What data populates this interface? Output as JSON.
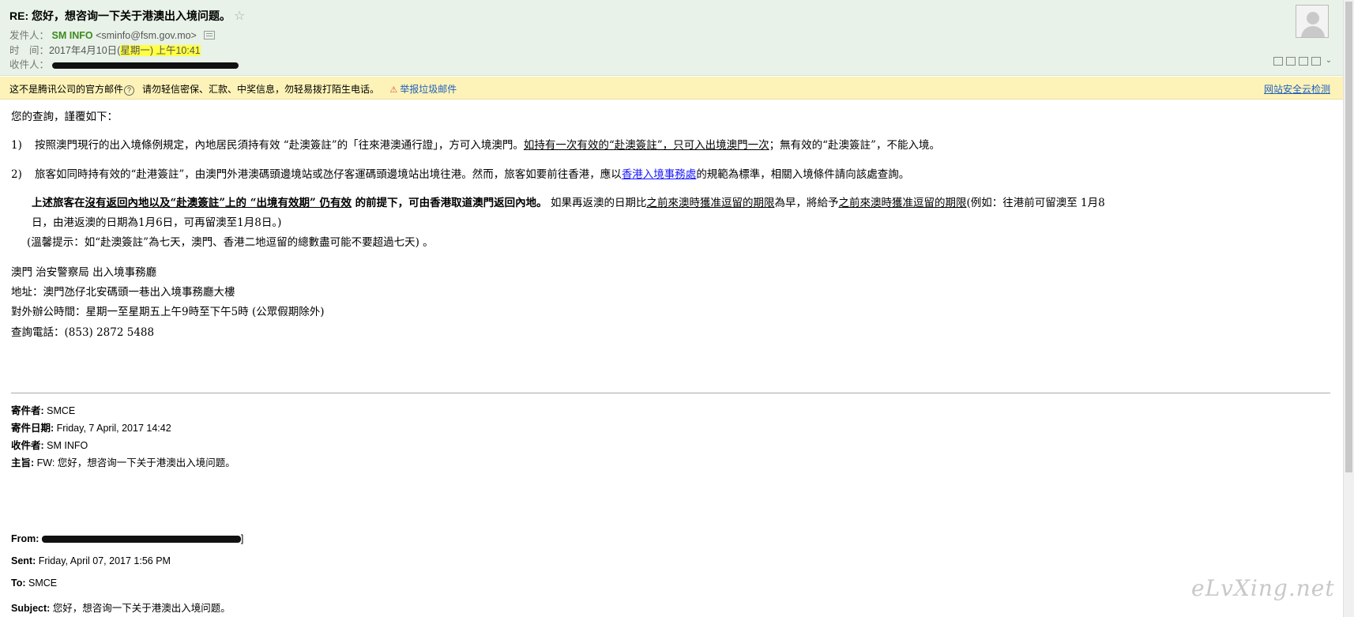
{
  "header": {
    "subject": "RE: 您好，想咨询一下关于港澳出入境问题。",
    "star": "☆",
    "sender_label": "发件人：",
    "sender_name": "SM INFO",
    "sender_email": "<sminfo@fsm.gov.mo>",
    "time_label": "时　间：",
    "time_value_a": "2017年4月10日(",
    "time_value_b": "星期一) 上午10:41",
    "recipient_label": "收件人："
  },
  "warning": {
    "text": "这不是腾讯公司的官方邮件",
    "help": "?",
    "notice": "请勿轻信密保、汇款、中奖信息，勿轻易拨打陌生电话。",
    "report_icon": "⚠",
    "report_link": "举报垃圾邮件",
    "safe_link": "网站安全云检测"
  },
  "body": {
    "greeting": "您的查詢，謹覆如下：",
    "item1_num": "1)",
    "item1_a": "按照澳門現行的出入境條例規定，內地居民須持有效 “赴澳簽註”的「往來港澳通行證」，方可入境澳門。",
    "item1_u": "如持有一次有效的“赴澳簽註”，只可入出境澳門一次",
    "item1_b": "；無有效的“赴澳簽註”，不能入境。",
    "item2_num": "2)",
    "item2_a": "旅客如同時持有效的“赴港簽註”，由澳門外港澳碼頭邊境站或氹仔客運碼頭邊境站出境往港。然而，旅客如要前往香港，應以",
    "item2_link": "香港入境事務處",
    "item2_b": "的規範為標準，相關入境條件請向該處查詢。",
    "bold_a": "上述旅客在",
    "bold_u1": "沒有返回內地以及",
    "bold_u2": "“赴澳簽註”上的 “出境有效期” 仍有效",
    "bold_b": " 的前提下，可由香港取道澳門返回內地。",
    "normal_a": " 如果再返澳的日期比",
    "normal_u1": "之前來澳時獲准逗留的期限",
    "normal_b": "為早，將給予",
    "normal_u2": "之前來澳時獲准逗留的期限",
    "normal_c": "(例如：往港前可留澳至 1月8",
    "cont_line": "日，由港返澳的日期為1月6日，可再留澳至1月8日。)",
    "tip": "(溫馨提示：如“赴澳簽註”為七天，澳門、香港二地逗留的總數盡可能不要超過七天) 。",
    "org": "澳門 治安警察局 出入境事務廳",
    "address": "地址：澳門氹仔北安碼頭一巷出入境事務廳大樓",
    "hours": "對外辦公時間：星期一至星期五上午9時至下午5時 (公眾假期除外)",
    "phone": "查詢電話：(853) 2872 5488"
  },
  "forward1": {
    "from_label": "寄件者:",
    "from_value": "SMCE",
    "date_label": "寄件日期:",
    "date_value": "Friday, 7 April, 2017 14:42",
    "to_label": "收件者:",
    "to_value": "SM INFO",
    "subject_label": "主旨:",
    "subject_value": "FW: 您好，想咨询一下关于港澳出入境问题。"
  },
  "forward2": {
    "from_label": "From:",
    "from_trailing": "]",
    "sent_label": "Sent:",
    "sent_value": "Friday, April 07, 2017 1:56 PM",
    "to_label": "To:",
    "to_value": "SMCE",
    "subject_label": "Subject:",
    "subject_value": "您好，想咨询一下关于港澳出入境问题。"
  },
  "watermark": "eLvXing.net",
  "colors": {
    "header_bg": "#e8f2e8",
    "warning_bg": "#fdf3b8",
    "sender_green": "#3b8a1c",
    "link_blue": "#1f5fbf"
  }
}
